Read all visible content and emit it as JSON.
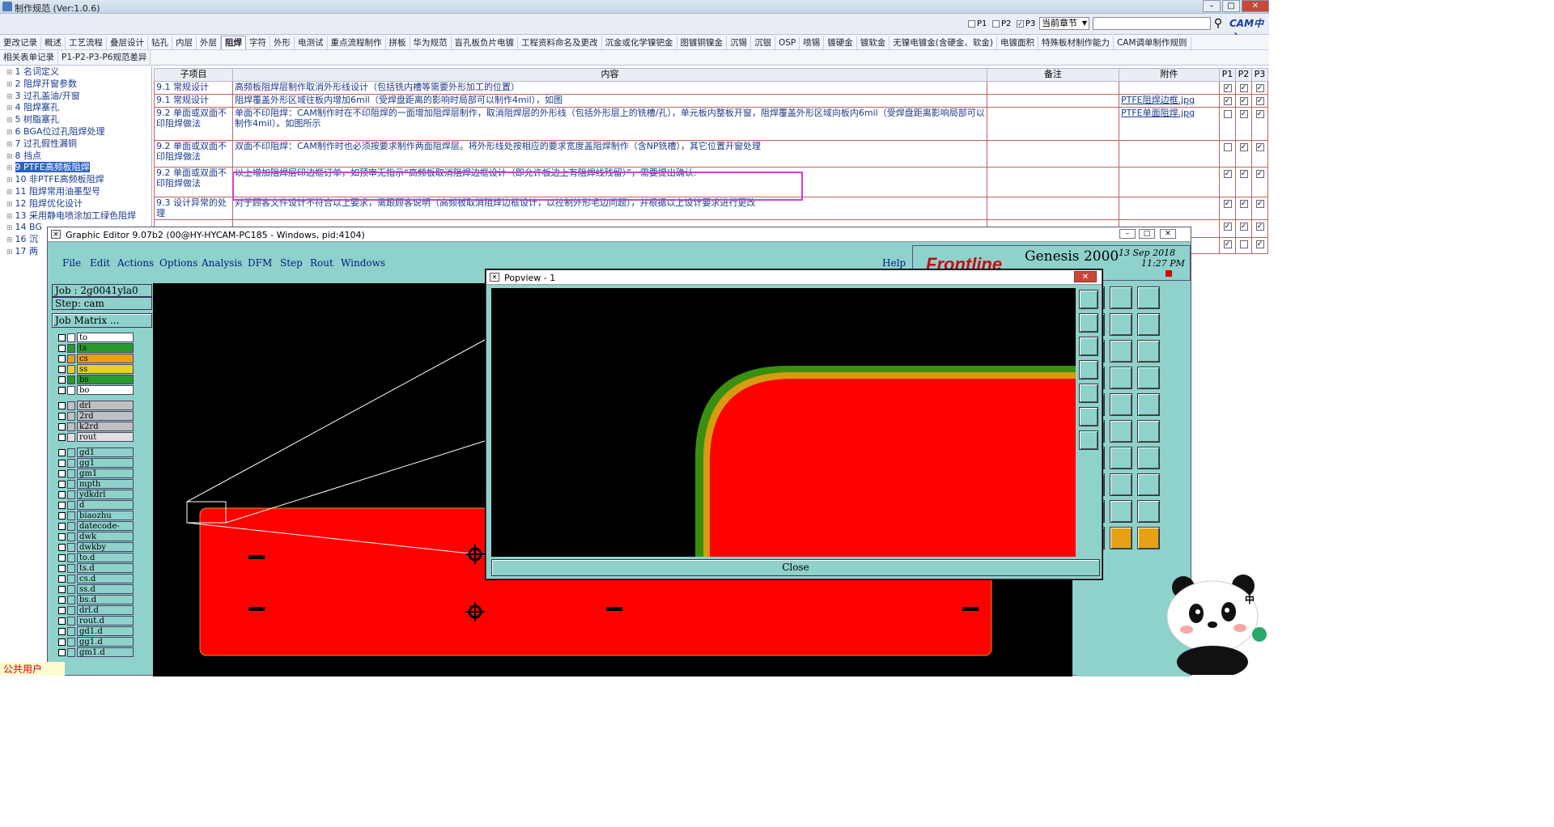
{
  "app": {
    "title": "制作规范 (Ver:1.0.6)",
    "window_controls": [
      "–",
      "□",
      "✕"
    ]
  },
  "toolbar": {
    "checks": [
      {
        "label": "P1",
        "checked": false
      },
      {
        "label": "P2",
        "checked": false
      },
      {
        "label": "P3",
        "checked": true
      }
    ],
    "scope_select": "当前章节",
    "search_value": "",
    "logo_text": "CAM中心"
  },
  "tabs_row1": [
    "更改记录",
    "概述",
    "工艺流程",
    "叠层设计",
    "钻孔",
    "内层",
    "外层",
    "阻焊",
    "字符",
    "外形",
    "电测试",
    "重点流程制作",
    "拼板",
    "华为规范",
    "盲孔板负片电镀",
    "工程资料命名及更改",
    "沉金或化学镍钯金",
    "图镀铜镍金",
    "沉锡",
    "沉银",
    "OSP",
    "喷锡",
    "镀硬金",
    "镀软金",
    "无镍电镀金(含硬金、软金)",
    "电镀面积",
    "特殊板材制作能力",
    "CAM调单制作规则"
  ],
  "active_tab": "阻焊",
  "tabs_row2": [
    "相关表单记录",
    "P1-P2-P3-P6规范差异"
  ],
  "tree": [
    "1  名词定义",
    "2  阻焊开窗参数",
    "3  过孔盖油/开窗",
    "4  阻焊塞孔",
    "5  树脂塞孔",
    "6  BGA位过孔阻焊处理",
    "7  过孔假性漏铜",
    "8  挡点",
    "9  PTFE高频板阻焊",
    "10  非PTFE高频板阻焊",
    "11  阻焊常用油墨型号",
    "12  阻焊优化设计",
    "13  采用静电喷涂加工绿色阻焊",
    "14  BG",
    "16  沉",
    "17  两"
  ],
  "tree_selected_index": 8,
  "status_text": "公共用户",
  "table": {
    "headers": [
      "子项目",
      "内容",
      "备注",
      "附件",
      "P1",
      "P2",
      "P3"
    ],
    "rows": [
      {
        "sub": "9.1 常规设计",
        "content": "高频板阻焊层制作取消外形线设计（包括铣内槽等需要外形加工的位置）",
        "note": "",
        "attach": "",
        "p": [
          true,
          true,
          true
        ]
      },
      {
        "sub": "9.1 常规设计",
        "content": "阻焊覆盖外形区域往板内增加6mil（受焊盘距离的影响时局部可以制作4mil），如图",
        "note": "",
        "attach": "PTFE阻焊边框.jpg",
        "p": [
          true,
          true,
          true
        ]
      },
      {
        "sub": "9.2 单面或双面不印阻焊做法",
        "content": "单面不印阻焊：CAM制作时在不印阻焊的一面增加阻焊层制作，取消阻焊层的外形线（包括外形层上的铣槽/孔），单元板内整板开窗，阻焊覆盖外形区域向板内6mil（受焊盘距离影响局部可以制作4mil）。如图所示",
        "note": "",
        "attach": "PTFE单面阻焊.jpg",
        "p": [
          false,
          true,
          true
        ]
      },
      {
        "sub": "9.2 单面或双面不印阻焊做法",
        "content": "双面不印阻焊：CAM制作时也必须按要求制作两面阻焊层。将外形线处按相应的要求宽度盖阻焊制作（含NP铣槽），其它位置开窗处理",
        "note": "",
        "attach": "",
        "p": [
          false,
          true,
          true
        ]
      },
      {
        "sub": "9.2 单面或双面不印阻焊做法",
        "content": "以上增加阻焊层印边框订单，如预审无指示“高频板取消阻焊边框设计（即允许板边上有阻焊线残留）”，需要提出确认.",
        "note": "",
        "attach": "",
        "p": [
          true,
          true,
          true
        ]
      },
      {
        "sub": "9.3 设计异常的处理",
        "content": "对于顾客文件设计不符合以上要求，需跟顾客说明（高频板取消阻焊边框设计，以控制外形毛边问题），并根据以上设计要求进行更改",
        "note": "",
        "attach": "",
        "p": [
          true,
          true,
          true
        ]
      },
      {
        "sub": "",
        "content": "",
        "note": "",
        "attach": "",
        "p": [
          true,
          true,
          true
        ]
      },
      {
        "sub": "",
        "content": "",
        "note": "",
        "attach": "",
        "p": [
          true,
          false,
          true
        ]
      }
    ]
  },
  "graphic_editor": {
    "title": "Graphic Editor 9.07b2 (00@HY-HYCAM-PC185 - Windows, pid:4104)",
    "menu": [
      "File",
      "Edit",
      "Actions",
      "Options",
      "Analysis",
      "DFM",
      "Step",
      "Rout",
      "Windows",
      "Help"
    ],
    "brand": "Frontline",
    "product": "Genesis 2000",
    "date": "13 Sep 2018",
    "time": "11:27 PM",
    "job": "Job : 2g0041yla0",
    "step": "Step: cam",
    "job_matrix": "Job Matrix ...",
    "layers": [
      {
        "name": "to",
        "color": "#ffffff"
      },
      {
        "name": "ts",
        "color": "#2a9a2a"
      },
      {
        "name": "cs",
        "color": "#e8a015"
      },
      {
        "name": "ss",
        "color": "#e8d030"
      },
      {
        "name": "bs",
        "color": "#2a9a2a"
      },
      {
        "name": "bo",
        "color": "#ffffff"
      },
      {
        "name": "drl",
        "color": "#c0c0c0"
      },
      {
        "name": "2rd",
        "color": "#c0c0c0"
      },
      {
        "name": "k2rd",
        "color": "#c0c0c0"
      },
      {
        "name": "rout",
        "color": "#e0e0e0"
      },
      {
        "name": "gd1",
        "color": ""
      },
      {
        "name": "gg1",
        "color": ""
      },
      {
        "name": "gm1",
        "color": ""
      },
      {
        "name": "mpth",
        "color": ""
      },
      {
        "name": "ydkdrl",
        "color": ""
      },
      {
        "name": "d",
        "color": ""
      },
      {
        "name": "biaozhu",
        "color": ""
      },
      {
        "name": "datecode-pbe",
        "color": ""
      },
      {
        "name": "dwk",
        "color": ""
      },
      {
        "name": "dwkby",
        "color": ""
      },
      {
        "name": "to.d",
        "color": ""
      },
      {
        "name": "ts.d",
        "color": ""
      },
      {
        "name": "cs.d",
        "color": ""
      },
      {
        "name": "ss.d",
        "color": ""
      },
      {
        "name": "bs.d",
        "color": ""
      },
      {
        "name": "drl.d",
        "color": ""
      },
      {
        "name": "rout.d",
        "color": ""
      },
      {
        "name": "gd1.d",
        "color": ""
      },
      {
        "name": "gg1.d",
        "color": ""
      },
      {
        "name": "gm1.d",
        "color": ""
      }
    ]
  },
  "popview": {
    "title": "Popview - 1",
    "close_label": "Close"
  },
  "colors": {
    "accent_tab": "#2a62c9",
    "board_red": "#ff0000",
    "mask_green": "#3b8f10",
    "mask_orange": "#d89a10",
    "ui_cyan": "#8fd1cb",
    "highlight_magenta": "#d33cd3"
  },
  "panda_label": "中"
}
